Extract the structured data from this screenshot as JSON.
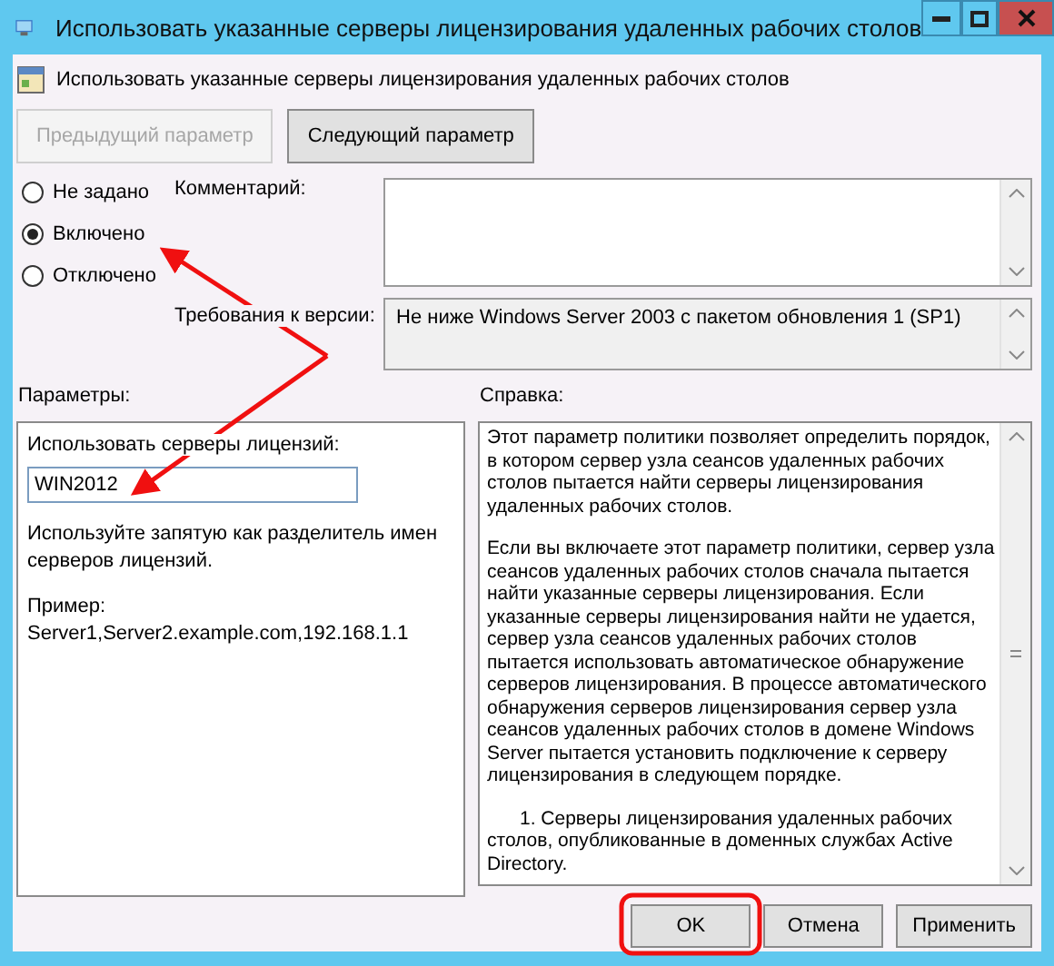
{
  "window": {
    "title": "Использовать указанные серверы лицензирования удаленных рабочих столов"
  },
  "header": {
    "text": "Использовать указанные серверы лицензирования удаленных рабочих столов"
  },
  "nav_buttons": [
    {
      "label": "Предыдущий параметр",
      "disabled": true
    },
    {
      "label": "Следующий параметр",
      "disabled": false
    }
  ],
  "states": [
    {
      "label": "Не задано",
      "selected": false
    },
    {
      "label": "Включено",
      "selected": true
    },
    {
      "label": "Отключено",
      "selected": false
    }
  ],
  "comment": {
    "label": "Комментарий:"
  },
  "requirements": {
    "label": "Требования к версии:",
    "value": "Не ниже Windows Server 2003 с пакетом обновления 1 (SP1)"
  },
  "options": {
    "label": "Параметры:",
    "field_label": "Использовать серверы лицензий:",
    "field_value": "WIN2012",
    "hint": "Используйте запятую как разделитель имен серверов лицензий.",
    "example": "Пример: Server1,Server2.example.com,192.168.1.1"
  },
  "help": {
    "label": "Справка:",
    "paragraphs": [
      "Этот параметр политики позволяет определить порядок, в котором сервер узла сеансов удаленных рабочих столов пытается найти серверы лицензирования удаленных рабочих столов.",
      "Если вы включаете этот параметр политики, сервер узла сеансов удаленных рабочих столов сначала пытается найти указанные серверы лицензирования. Если указанные серверы лицензирования найти не удается, сервер узла сеансов удаленных рабочих столов пытается использовать автоматическое обнаружение серверов лицензирования. В процессе автоматического обнаружения серверов лицензирования сервер узла сеансов удаленных рабочих столов в домене Windows Server пытается установить подключение к серверу лицензирования в следующем порядке.",
      "1. Серверы лицензирования удаленных рабочих столов, опубликованные в доменных службах Active Directory."
    ]
  },
  "buttons": [
    {
      "label": "OK"
    },
    {
      "label": "Отмена"
    },
    {
      "label": "Применить"
    }
  ]
}
